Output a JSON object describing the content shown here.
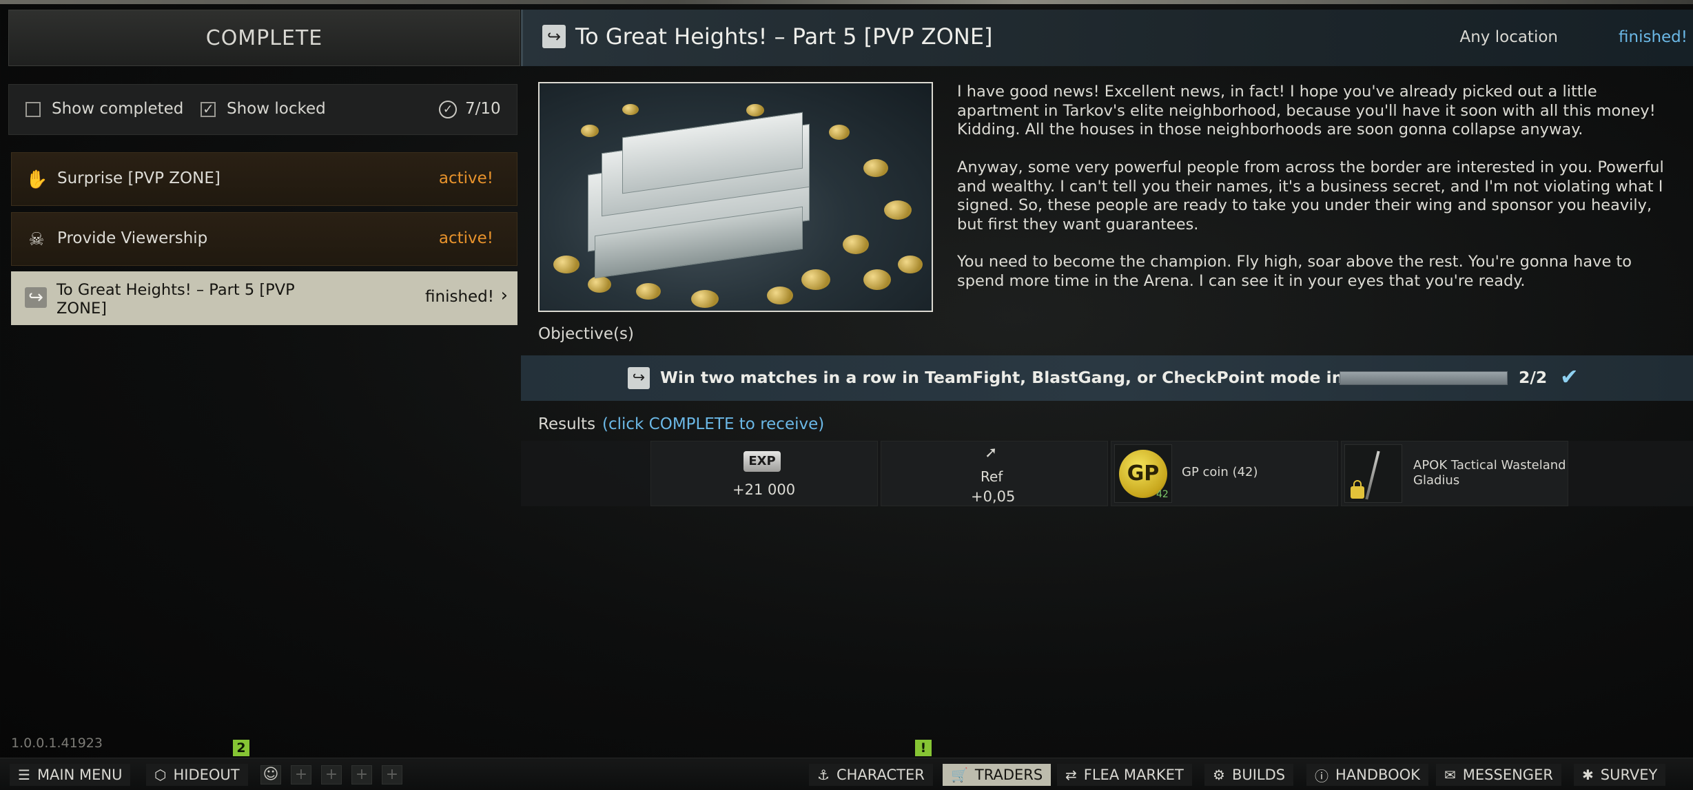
{
  "left_panel": {
    "complete_label": "COMPLETE",
    "show_completed_label": "Show completed",
    "show_locked_label": "Show locked",
    "show_completed_checked": false,
    "show_locked_checked": true,
    "count": "7/10",
    "quests": [
      {
        "name": "Surprise [PVP ZONE]",
        "status": "active!",
        "icon": "hand-icon"
      },
      {
        "name": "Provide Viewership",
        "status": "active!",
        "icon": "skull-icon"
      },
      {
        "name": "To Great Heights! – Part 5 [PVP ZONE]",
        "status": "finished!",
        "icon": "exit-icon"
      }
    ]
  },
  "header": {
    "title": "To Great Heights! – Part 5 [PVP ZONE]",
    "location": "Any location",
    "status": "finished!"
  },
  "description": [
    "I have good news! Excellent news, in fact! I hope you've already picked out a little apartment in Tarkov's elite neighborhood, because you'll have it soon with all this money! Kidding. All the houses in those neighborhoods are soon gonna collapse anyway.",
    "Anyway, some very powerful people from across the border are interested in you. Powerful and wealthy. I can't tell you their names, it's a business secret, and I'm not violating what I signed. So, these people are ready to take you under their wing and sponsor you heavily, but first they want guarantees.",
    "You need to become the champion. Fly high, soar above the rest. You're gonna have to spend more time in the Arena. I can see it in your eyes that you're ready."
  ],
  "objectives": {
    "label": "Objective(s)",
    "items": [
      {
        "text": "Win two matches in a row in TeamFight, BlastGang, or CheckPoint mode in Arena",
        "progress": "2/2",
        "fraction": 1.0
      }
    ]
  },
  "results": {
    "label": "Results",
    "hint": "(click COMPLETE to receive)",
    "exp_badge": "EXP",
    "exp_value": "+21 000",
    "ref_name": "Ref",
    "ref_value": "+0,05",
    "gp_name": "GP coin (42)",
    "gp_icon_text": "GP",
    "gp_qty": "42",
    "item_name": "APOK Tactical Wasteland Gladius"
  },
  "version": "1.0.0.1.41923",
  "bottom_nav": {
    "main_menu": "MAIN MENU",
    "hideout": "HIDEOUT",
    "hideout_badge": "2",
    "character": "CHARACTER",
    "traders": "TRADERS",
    "traders_badge": "!",
    "flea_market": "FLEA MARKET",
    "builds": "BUILDS",
    "handbook": "HANDBOOK",
    "messenger": "MESSENGER",
    "survey": "SURVEY"
  },
  "colors": {
    "active_status": "#e8932c",
    "finished_status": "#6bb8e6",
    "badge_green": "#86c534"
  }
}
